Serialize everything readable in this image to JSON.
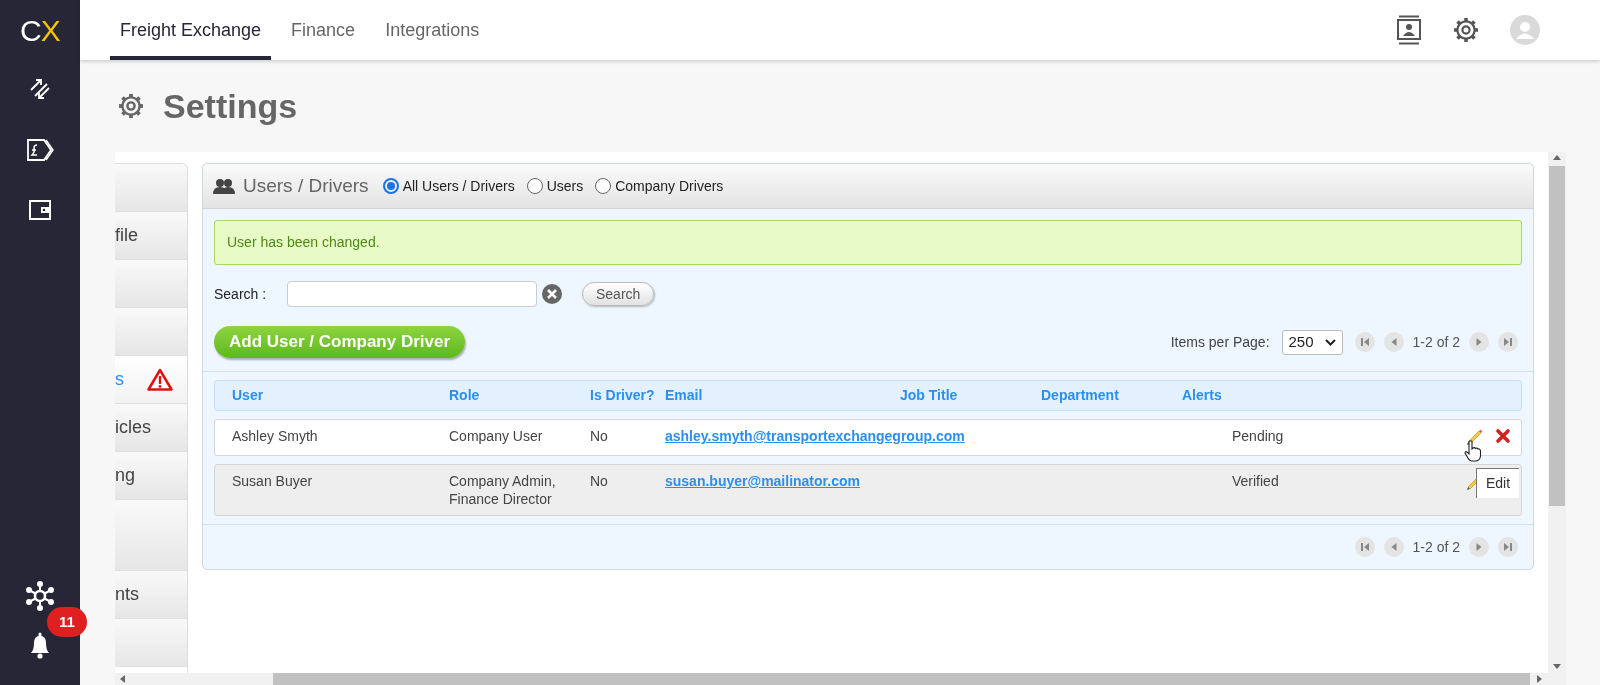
{
  "app": {
    "logo": "CX"
  },
  "top_tabs": [
    {
      "label": "Freight Exchange",
      "selected": true
    },
    {
      "label": "Finance",
      "selected": false
    },
    {
      "label": "Integrations",
      "selected": false
    }
  ],
  "notifications": {
    "count": "11"
  },
  "page_title": "Settings",
  "settings_nav": [
    {
      "selected": false
    },
    {
      "label": "file",
      "selected": false
    },
    {
      "selected": false
    },
    {
      "selected": false
    },
    {
      "label": "s",
      "selected": true,
      "warning": true
    },
    {
      "label": "icles",
      "selected": false
    },
    {
      "label": "ng",
      "selected": false
    },
    {
      "selected": false
    },
    {
      "label": "nts",
      "selected": false
    },
    {
      "selected": false
    }
  ],
  "panel": {
    "title": "Users / Drivers",
    "filters": [
      {
        "label": "All Users / Drivers",
        "selected": true
      },
      {
        "label": "Users",
        "selected": false
      },
      {
        "label": "Company Drivers",
        "selected": false
      }
    ],
    "message": "User has been changed.",
    "search": {
      "label": "Search :",
      "button": "Search"
    },
    "add_button": "Add User / Company Driver",
    "items_per_page": {
      "label": "Items per Page:",
      "value": "250"
    },
    "pager": {
      "range": "1-2 of 2"
    },
    "footer_pager": {
      "range": "1-2 of 2"
    },
    "table": {
      "columns": [
        "User",
        "Role",
        "Is Driver?",
        "Email",
        "Job Title",
        "Department",
        "Alerts"
      ],
      "rows": [
        {
          "user": "Ashley Smyth",
          "role": "Company User",
          "is_driver": "No",
          "email": "ashley.smyth@transportexchangegroup.com",
          "status": "Pending"
        },
        {
          "user": "Susan Buyer",
          "role": "Company Admin, Finance Director",
          "is_driver": "No",
          "email": "susan.buyer@mailinator.com",
          "status": "Verified"
        }
      ]
    },
    "tooltip": "Edit"
  }
}
